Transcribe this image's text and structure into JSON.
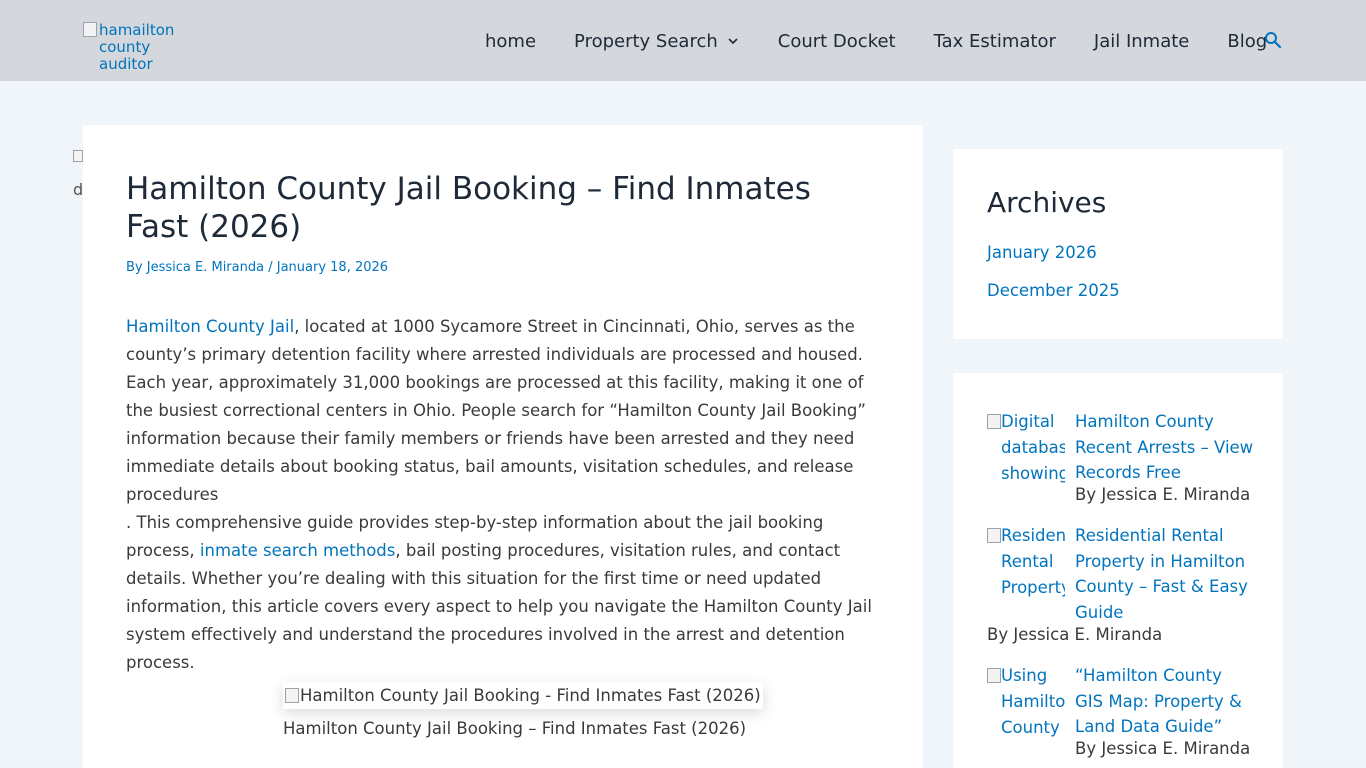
{
  "header": {
    "logo_alt": "hamailton county auditor",
    "nav": {
      "home": "home",
      "property_search": "Property Search",
      "court_docket": "Court Docket",
      "tax_estimator": "Tax Estimator",
      "jail_inmate": "Jail Inmate",
      "blog": "Blog"
    },
    "icons": {
      "search": "search-icon",
      "dropdown": "chevron-down-icon"
    }
  },
  "article": {
    "lost_image_text": "d",
    "title": "Hamilton County Jail Booking – Find Inmates Fast (2026)",
    "meta": {
      "by": "By",
      "author": "Jessica E. Miranda",
      "sep": " / ",
      "date": "January 18, 2026"
    },
    "p1": {
      "link": "Hamilton County Jail",
      "text": ", located at 1000 Sycamore Street in Cincinnati, Ohio, serves as the county’s primary detention facility where arrested individuals are processed and housed. Each year, approximately 31,000 bookings are processed at this facility, making it one of the busiest correctional centers in Ohio. People search for “Hamilton County Jail Booking” information because their family members or friends have been arrested and they need immediate details about booking status, bail amounts, visitation schedules, and release procedures"
    },
    "p2": {
      "lead": ". This comprehensive guide provides step-by-step information about the jail booking process, ",
      "link": "inmate search methods",
      "text": ", bail posting procedures, visitation rules, and contact details. Whether you’re dealing with this situation for the first time or need updated information, this article covers every aspect to help you navigate the Hamilton County Jail system effectively and understand the procedures involved in the arrest and detention process."
    },
    "figure": {
      "alt": "Hamilton County Jail Booking - Find Inmates Fast (2026)",
      "caption": "Hamilton County Jail Booking – Find Inmates Fast (2026)"
    }
  },
  "sidebar": {
    "archives": {
      "title": "Archives",
      "items": [
        "January 2026",
        "December 2025"
      ]
    },
    "recent": [
      {
        "thumb_alt": "Digital database showing",
        "title": "Hamilton County Recent Arrests – View Records Free",
        "by": "By Jessica E. Miranda"
      },
      {
        "thumb_alt": "Residential Rental Property",
        "title": "Residential Rental Property in Hamilton County – Fast & Easy Guide",
        "by": "By Jessica E. Miranda"
      },
      {
        "thumb_alt": "Using Hamilton County",
        "title": "“Hamilton County GIS Map: Property & Land Data Guide”",
        "by": "By Jessica E. Miranda"
      }
    ]
  },
  "colors": {
    "link": "#0274be",
    "header_bg": "#d4d7db",
    "page_bg": "#f0f5fa",
    "heading": "#1e2a38",
    "body_text": "#3a3a3a"
  }
}
